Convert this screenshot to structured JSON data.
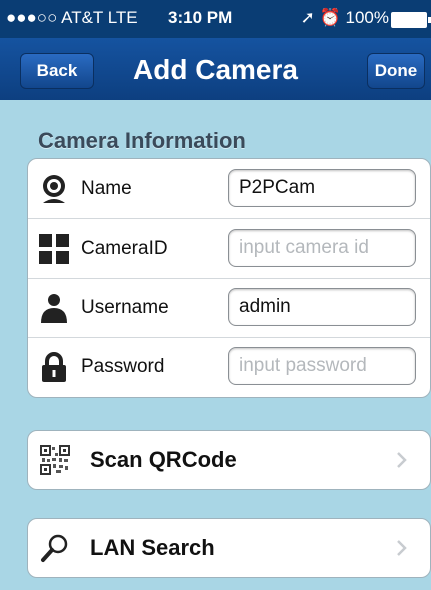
{
  "status_bar": {
    "carrier": "●●●○○ AT&T  LTE",
    "time": "3:10 PM",
    "right": "➚ ⏰ 100%"
  },
  "nav": {
    "back_label": "Back",
    "title": "Add Camera",
    "done_label": "Done"
  },
  "section": {
    "header": "Camera Information"
  },
  "fields": {
    "name": {
      "label": "Name",
      "value": "P2PCam",
      "icon": "webcam-icon"
    },
    "camera_id": {
      "label": "CameraID",
      "value": "",
      "placeholder": "input camera id",
      "icon": "grid-icon"
    },
    "username": {
      "label": "Username",
      "value": "admin",
      "icon": "user-icon"
    },
    "password": {
      "label": "Password",
      "value": "",
      "placeholder": "input password",
      "icon": "lock-icon"
    }
  },
  "actions": {
    "scan": {
      "label": "Scan QRCode",
      "icon": "qrcode-icon"
    },
    "lan": {
      "label": "LAN Search",
      "icon": "magnifier-icon"
    }
  },
  "colors": {
    "nav_bg": "#1553a0",
    "status_bg": "#0a3d74",
    "page_bg": "#a9d6e5"
  }
}
